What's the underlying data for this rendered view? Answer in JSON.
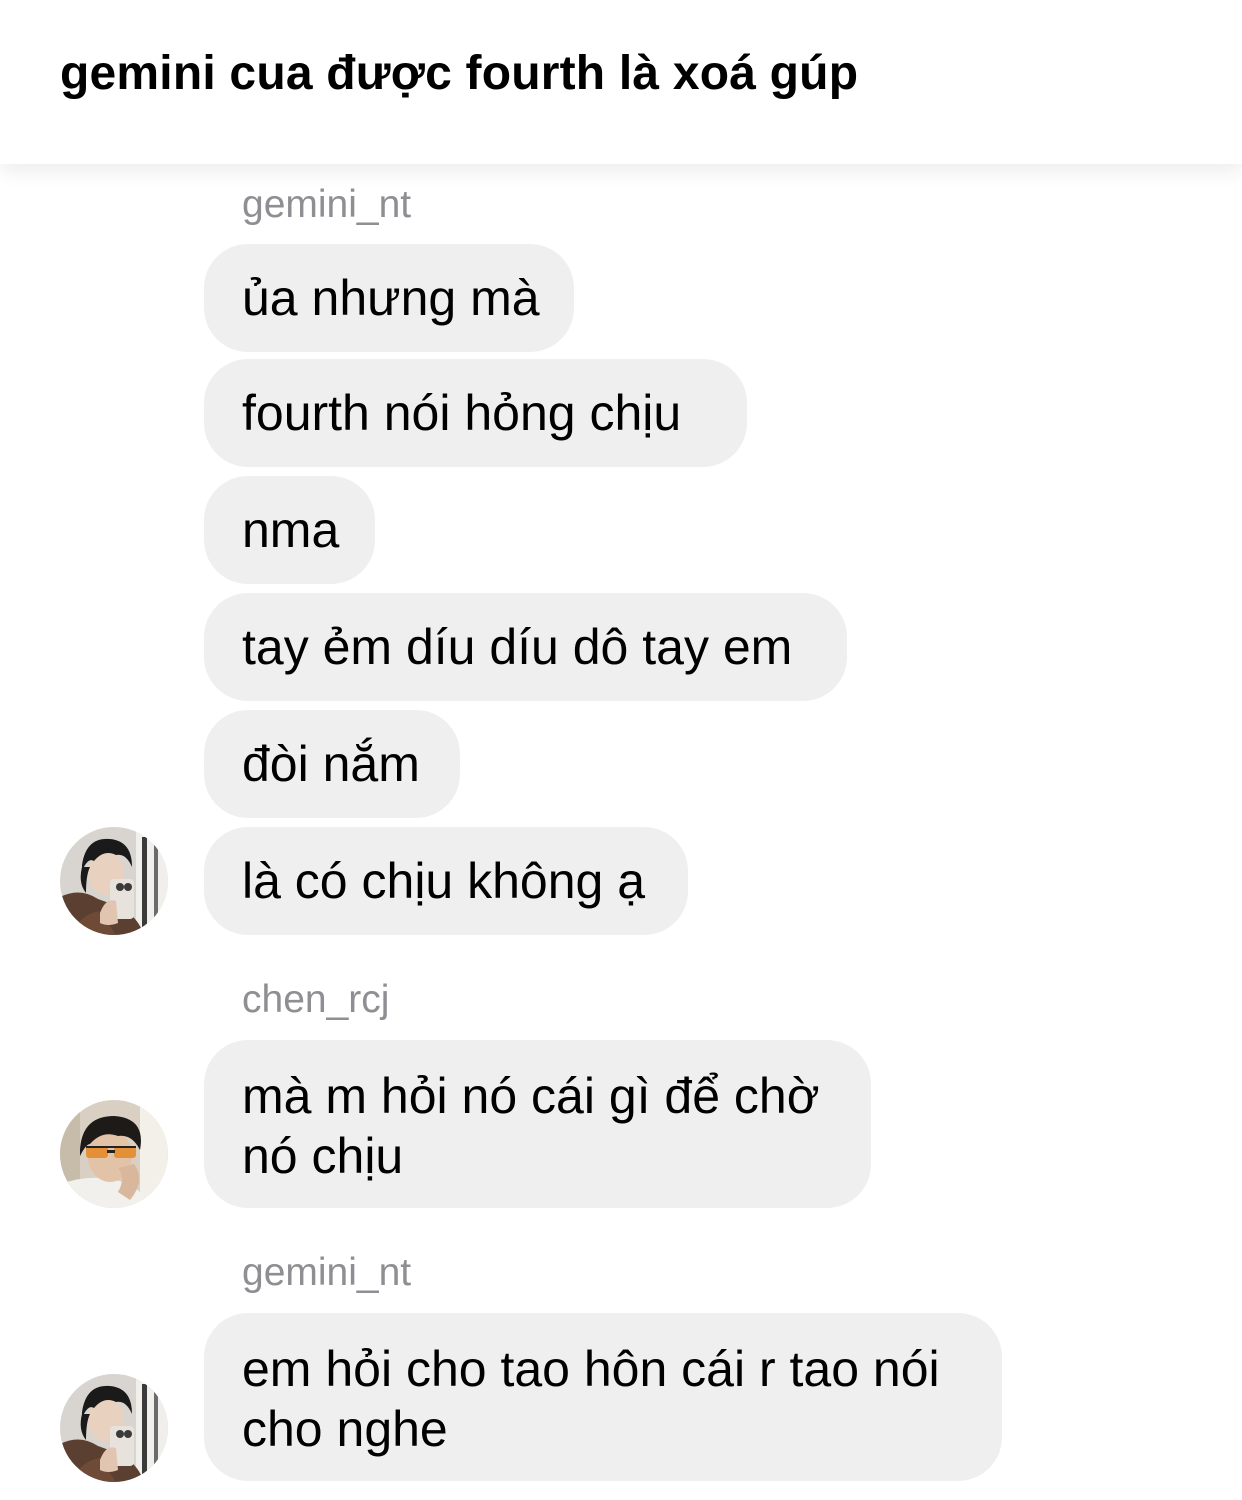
{
  "header": {
    "title": "gemini cua được fourth là xoá gúp"
  },
  "messages": {
    "group1": {
      "sender": "gemini_nt",
      "bubbles": [
        "ủa nhưng mà",
        "fourth nói hỏng chịu",
        "nma",
        "tay ẻm díu díu dô tay em",
        "đòi nắm",
        "là có chịu không ạ"
      ],
      "avatar": "profile-photo-gemini"
    },
    "group2": {
      "sender": "chen_rcj",
      "bubbles": [
        "mà m hỏi nó cái gì để chờ nó chịu"
      ],
      "avatar": "profile-photo-chen"
    },
    "group3": {
      "sender": "gemini_nt",
      "bubbles": [
        "em hỏi cho tao hôn cái r tao nói cho nghe"
      ],
      "avatar": "profile-photo-gemini"
    }
  },
  "colors": {
    "bubble_background": "#efefef",
    "sender_text": "#8e8e93",
    "page_background": "#ffffff"
  }
}
